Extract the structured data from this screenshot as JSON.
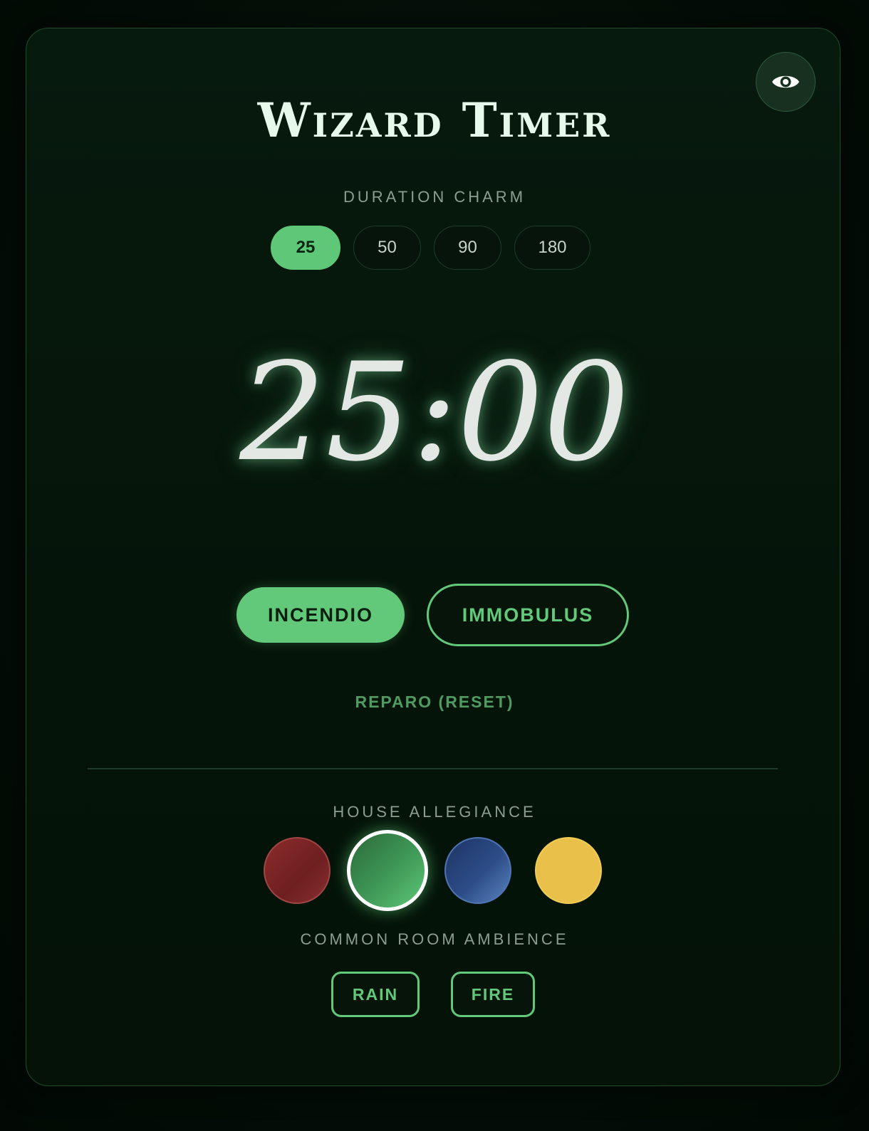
{
  "title": "Wizard Timer",
  "visibility_toggle": {
    "icon": "eye-icon"
  },
  "duration": {
    "label": "DURATION CHARM",
    "options": [
      "25",
      "50",
      "90",
      "180"
    ],
    "selected": "25"
  },
  "timer": {
    "display": "25:00"
  },
  "controls": {
    "start_label": "INCENDIO",
    "pause_label": "IMMOBULUS",
    "reset_label": "REPARO (RESET)"
  },
  "house": {
    "label": "HOUSE ALLEGIANCE",
    "options": [
      {
        "name": "red",
        "color": "#7a2424"
      },
      {
        "name": "green",
        "color": "#3f9957"
      },
      {
        "name": "blue",
        "color": "#2c4c86"
      },
      {
        "name": "yellow",
        "color": "#e8c04a"
      }
    ],
    "selected": "green"
  },
  "ambience": {
    "label": "COMMON ROOM AMBIENCE",
    "options": [
      "RAIN",
      "FIRE"
    ]
  },
  "colors": {
    "accent": "#62c97a",
    "background": "#051409",
    "title": "#e6f9ea"
  }
}
